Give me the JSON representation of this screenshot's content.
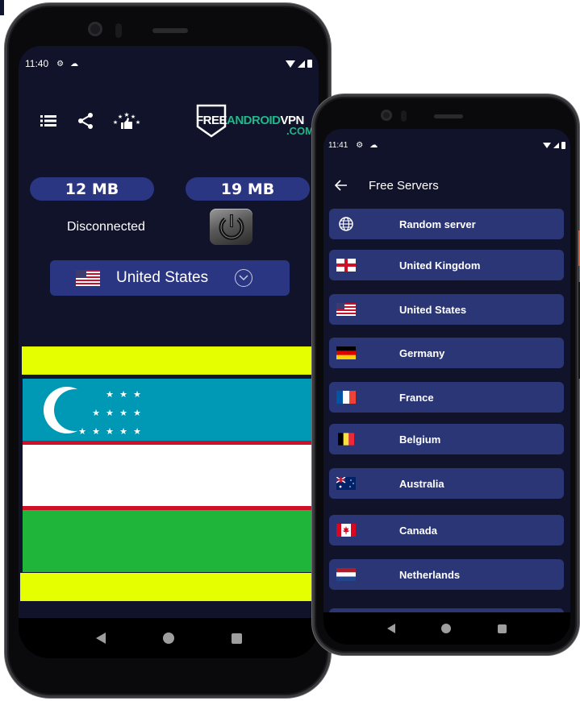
{
  "phone_main": {
    "status_bar": {
      "time": "11:40",
      "icons": [
        "gear-icon",
        "cloud-icon"
      ],
      "right_icons": [
        "wifi-icon",
        "signal-icon",
        "battery-icon"
      ]
    },
    "toolbar": {
      "icons": [
        "server-list-icon",
        "share-icon",
        "rate-icon"
      ]
    },
    "logo": {
      "free": "FREE",
      "android": "ANDROID",
      "vpn": "VPN",
      "dotcom": ".COM"
    },
    "download": "12 MB",
    "upload": "19 MB",
    "connection_status": "Disconnected",
    "selected_country": {
      "label": "United States",
      "flag": "us-flag"
    },
    "banner_colors": {
      "top": "#e6ff00",
      "bottom": "#e6ff00"
    },
    "ad_flag": "uzbekistan-flag",
    "navbar": [
      "back",
      "home",
      "recents"
    ]
  },
  "phone_servers": {
    "status_bar": {
      "time": "11:41",
      "icons": [
        "gear-icon",
        "cloud-icon"
      ],
      "right_icons": [
        "wifi-icon",
        "signal-icon",
        "battery-icon"
      ]
    },
    "header": {
      "title": "Free Servers"
    },
    "servers": [
      {
        "label": "Random server",
        "icon": "globe"
      },
      {
        "label": "United Kingdom",
        "icon": "gb-flag"
      },
      {
        "label": "United States",
        "icon": "us-flag"
      },
      {
        "label": "Germany",
        "icon": "de-flag"
      },
      {
        "label": "France",
        "icon": "fr-flag"
      },
      {
        "label": "Belgium",
        "icon": "be-flag"
      },
      {
        "label": "Australia",
        "icon": "au-flag"
      },
      {
        "label": "Canada",
        "icon": "ca-flag"
      },
      {
        "label": "Netherlands",
        "icon": "nl-flag"
      }
    ],
    "navbar": [
      "back",
      "home",
      "recents"
    ]
  },
  "colors": {
    "background": "#10132a",
    "accent": "#2b3683",
    "logo_green": "#1fb889"
  }
}
